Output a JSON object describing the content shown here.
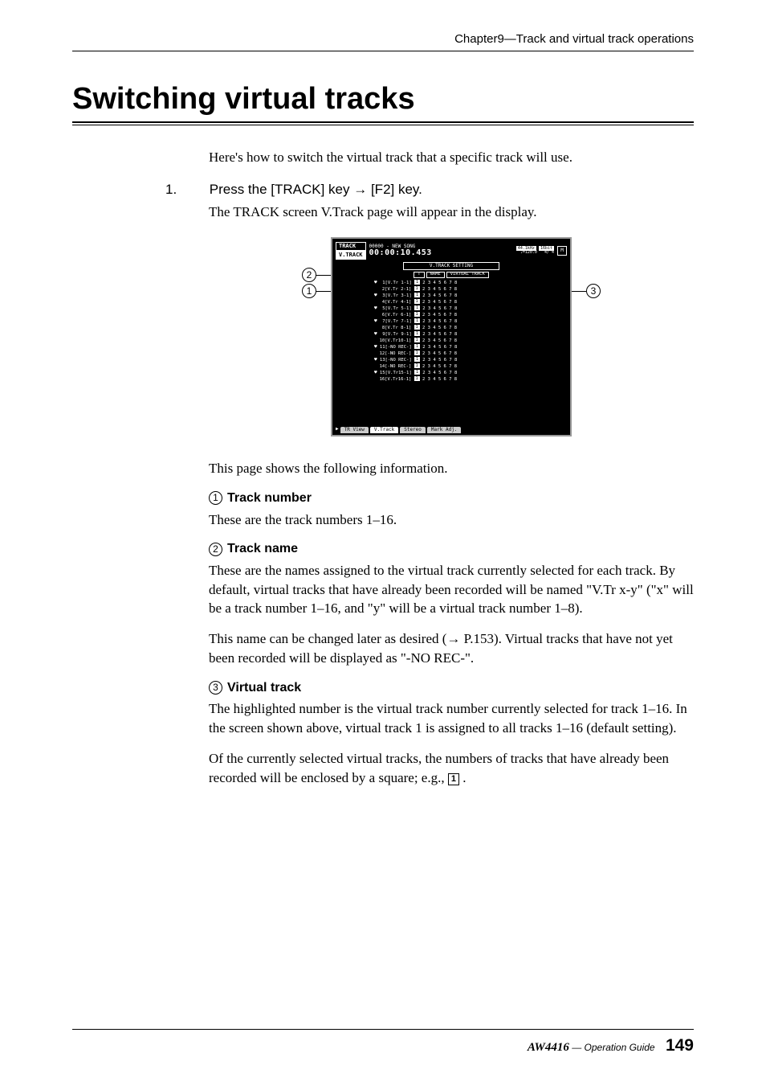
{
  "header": {
    "chapter": "Chapter9—Track and virtual track operations"
  },
  "title": "Switching virtual tracks",
  "intro": "Here's how to switch the virtual track that a specific track will use.",
  "step": {
    "num": "1.",
    "label_a": "Press the [TRACK] key ",
    "arrow": "→",
    "label_b": " [F2] key.",
    "sub": "The TRACK screen V.Track page will appear in the display."
  },
  "screenshot": {
    "top_label": "TRACK",
    "sub_label": "V.TRACK",
    "counter": "00000 - NEW SONG",
    "time": "00:00:10.453",
    "rate": "44.1kHz",
    "bits": "16bit",
    "tempo": "♩=120.0",
    "sig": "4/ 4",
    "heading": "V.TRACK SETTING",
    "col_t": "T",
    "col_name": "NAME",
    "col_vt": "VIRTUAL TRACK",
    "rows": [
      {
        "n": "1",
        "name": "[V.Tr 1-1]",
        "nums": "2 3 4 5 6 7 8"
      },
      {
        "n": "2",
        "name": "[V.Tr 2-1]",
        "nums": "2 3 4 5 6 7 8"
      },
      {
        "n": "3",
        "name": "[V.Tr 3-1]",
        "nums": "2 3 4 5 6 7 8"
      },
      {
        "n": "4",
        "name": "[V.Tr 4-1]",
        "nums": "2 3 4 5 6 7 8"
      },
      {
        "n": "5",
        "name": "[V.Tr 5-1]",
        "nums": "2 3 4 5 6 7 8"
      },
      {
        "n": "6",
        "name": "[V.Tr 6-1]",
        "nums": "2 3 4 5 6 7 8"
      },
      {
        "n": "7",
        "name": "[V.Tr 7-1]",
        "nums": "2 3 4 5 6 7 8"
      },
      {
        "n": "8",
        "name": "[V.Tr 8-1]",
        "nums": "2 3 4 5 6 7 8"
      },
      {
        "n": "9",
        "name": "[V.Tr 9-1]",
        "nums": "2 3 4 5 6 7 8"
      },
      {
        "n": "10",
        "name": "[V.Tr10-1]",
        "nums": "2 3 4 5 6 7 8"
      },
      {
        "n": "11",
        "name": "[-NO REC-]",
        "nums": "2 3 4 5 6 7 8"
      },
      {
        "n": "12",
        "name": "[-NO REC-]",
        "nums": "2 3 4 5 6 7 8"
      },
      {
        "n": "13",
        "name": "[-NO REC-]",
        "nums": "2 3 4 5 6 7 8"
      },
      {
        "n": "14",
        "name": "[-NO REC-]",
        "nums": "2 3 4 5 6 7 8"
      },
      {
        "n": "15",
        "name": "[V.Tr15-1]",
        "nums": "2 3 4 5 6 7 8"
      },
      {
        "n": "16",
        "name": "[V.Tr16-1]",
        "nums": "2 3 4 5 6 7 8"
      }
    ],
    "tabs": [
      "TR View",
      "V.Track",
      "Stereo",
      "Mark Adj."
    ]
  },
  "callouts": {
    "c1": "1",
    "c2": "2",
    "c3": "3"
  },
  "info_lead": "This page shows the following information.",
  "items": [
    {
      "num": "1",
      "title": "Track number",
      "desc": [
        "These are the track numbers 1–16."
      ]
    },
    {
      "num": "2",
      "title": "Track name",
      "desc": [
        "These are the names assigned to the virtual track currently selected for each track. By default, virtual tracks that have already been recorded will be named \"V.Tr x-y\" (\"x\" will be a track number 1–16, and \"y\" will be a virtual track number 1–8).",
        "This name can be changed later as desired (→ P.153). Virtual tracks that have not yet been recorded will be displayed as \"-NO REC-\"."
      ]
    },
    {
      "num": "3",
      "title": "Virtual track",
      "desc": [
        "The highlighted number is the virtual track number currently selected for track 1–16. In the screen shown above, virtual track 1 is assigned to all tracks 1–16 (default setting).",
        "Of the currently selected virtual tracks, the numbers of tracks that have already been recorded will be enclosed by a square; e.g., "
      ],
      "square": "1",
      "tail": "."
    }
  ],
  "footer": {
    "model": "AW4416",
    "guide": " — Operation Guide",
    "page": "149"
  }
}
